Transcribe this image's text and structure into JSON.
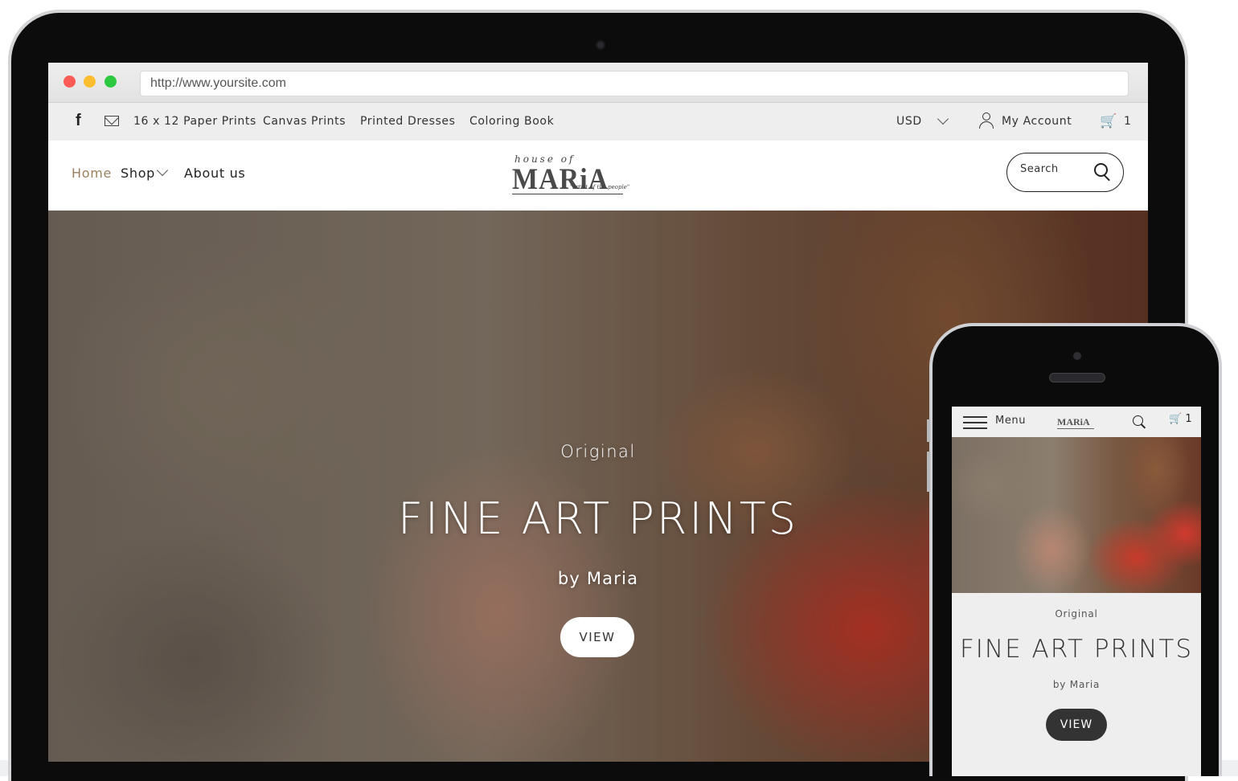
{
  "browser": {
    "url": "http://www.yoursite.com"
  },
  "topbar": {
    "facebook_icon": "f",
    "links": [
      "16 x 12 Paper Prints",
      "Canvas Prints",
      "Printed Dresses",
      "Coloring Book"
    ],
    "currency": "USD",
    "account_label": "My Account",
    "cart_icon": "🛒",
    "cart_count": "1"
  },
  "header": {
    "nav": {
      "home": "Home",
      "shop": "Shop",
      "about": "About us"
    },
    "logo": {
      "line1": "house of",
      "line2": "MARiA",
      "tagline": "\"artist of the people\""
    },
    "search_placeholder": "Search"
  },
  "hero": {
    "subtitle": "Original",
    "title": "FINE ART PRINTS",
    "byline": "by Maria",
    "button": "VIEW",
    "colors": {
      "scarf_red": "#d23a2e",
      "skin": "#b78672",
      "background": "#8c7e6e"
    }
  },
  "mobile": {
    "menu_label": "Menu",
    "logo": "MARiA",
    "cart_icon": "🛒",
    "cart_count": "1",
    "subtitle": "Original",
    "title": "FINE ART PRINTS",
    "byline": "by Maria",
    "button": "VIEW"
  }
}
